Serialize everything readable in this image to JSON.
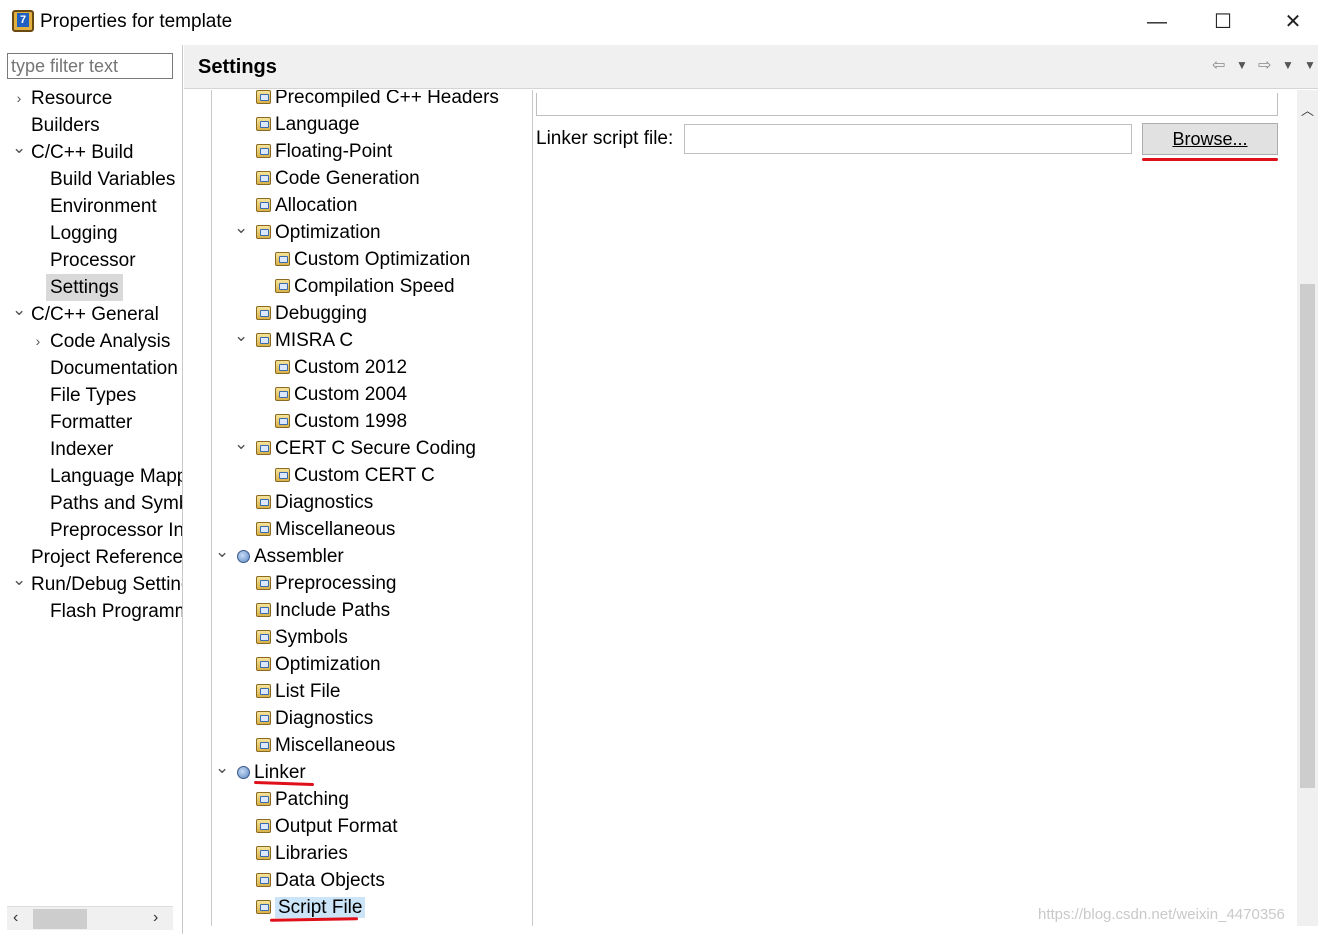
{
  "window": {
    "title": "Properties for template",
    "minimize": "—",
    "maximize": "☐",
    "close": "✕"
  },
  "filter": {
    "placeholder": "type filter text"
  },
  "left_nav": [
    {
      "label": "Resource",
      "level": 0,
      "expander": "collapsed"
    },
    {
      "label": "Builders",
      "level": 0,
      "expander": "none"
    },
    {
      "label": "C/C++ Build",
      "level": 0,
      "expander": "expanded"
    },
    {
      "label": "Build Variables",
      "level": 1,
      "expander": "none"
    },
    {
      "label": "Environment",
      "level": 1,
      "expander": "none"
    },
    {
      "label": "Logging",
      "level": 1,
      "expander": "none"
    },
    {
      "label": "Processor",
      "level": 1,
      "expander": "none"
    },
    {
      "label": "Settings",
      "level": 1,
      "expander": "none",
      "selected": true
    },
    {
      "label": "C/C++ General",
      "level": 0,
      "expander": "expanded"
    },
    {
      "label": "Code Analysis",
      "level": 1,
      "expander": "collapsed"
    },
    {
      "label": "Documentation",
      "level": 1,
      "expander": "none"
    },
    {
      "label": "File Types",
      "level": 1,
      "expander": "none"
    },
    {
      "label": "Formatter",
      "level": 1,
      "expander": "none"
    },
    {
      "label": "Indexer",
      "level": 1,
      "expander": "none"
    },
    {
      "label": "Language Mappings",
      "level": 1,
      "expander": "none"
    },
    {
      "label": "Paths and Symbols",
      "level": 1,
      "expander": "none"
    },
    {
      "label": "Preprocessor Include",
      "level": 1,
      "expander": "none"
    },
    {
      "label": "Project References",
      "level": 0,
      "expander": "none"
    },
    {
      "label": "Run/Debug Settings",
      "level": 0,
      "expander": "expanded"
    },
    {
      "label": "Flash Programmer",
      "level": 1,
      "expander": "none"
    }
  ],
  "header": {
    "title": "Settings"
  },
  "tree": [
    {
      "label": "Precompiled C++ Headers",
      "level": 2,
      "icon": "folder",
      "expander": "none"
    },
    {
      "label": "Language",
      "level": 2,
      "icon": "folder",
      "expander": "none"
    },
    {
      "label": "Floating-Point",
      "level": 2,
      "icon": "folder",
      "expander": "none"
    },
    {
      "label": "Code Generation",
      "level": 2,
      "icon": "folder",
      "expander": "none"
    },
    {
      "label": "Allocation",
      "level": 2,
      "icon": "folder",
      "expander": "none"
    },
    {
      "label": "Optimization",
      "level": 2,
      "icon": "folder",
      "expander": "expanded"
    },
    {
      "label": "Custom Optimization",
      "level": 3,
      "icon": "folder",
      "expander": "none"
    },
    {
      "label": "Compilation Speed",
      "level": 3,
      "icon": "folder",
      "expander": "none"
    },
    {
      "label": "Debugging",
      "level": 2,
      "icon": "folder",
      "expander": "none"
    },
    {
      "label": "MISRA C",
      "level": 2,
      "icon": "folder",
      "expander": "expanded"
    },
    {
      "label": "Custom 2012",
      "level": 3,
      "icon": "folder",
      "expander": "none"
    },
    {
      "label": "Custom 2004",
      "level": 3,
      "icon": "folder",
      "expander": "none"
    },
    {
      "label": "Custom 1998",
      "level": 3,
      "icon": "folder",
      "expander": "none"
    },
    {
      "label": "CERT C Secure Coding",
      "level": 2,
      "icon": "folder",
      "expander": "expanded"
    },
    {
      "label": "Custom CERT C",
      "level": 3,
      "icon": "folder",
      "expander": "none"
    },
    {
      "label": "Diagnostics",
      "level": 2,
      "icon": "folder",
      "expander": "none"
    },
    {
      "label": "Miscellaneous",
      "level": 2,
      "icon": "folder",
      "expander": "none"
    },
    {
      "label": "Assembler",
      "level": 1,
      "icon": "globe",
      "expander": "expanded"
    },
    {
      "label": "Preprocessing",
      "level": 2,
      "icon": "folder",
      "expander": "none"
    },
    {
      "label": "Include Paths",
      "level": 2,
      "icon": "folder",
      "expander": "none"
    },
    {
      "label": "Symbols",
      "level": 2,
      "icon": "folder",
      "expander": "none"
    },
    {
      "label": "Optimization",
      "level": 2,
      "icon": "folder",
      "expander": "none"
    },
    {
      "label": "List File",
      "level": 2,
      "icon": "folder",
      "expander": "none"
    },
    {
      "label": "Diagnostics",
      "level": 2,
      "icon": "folder",
      "expander": "none"
    },
    {
      "label": "Miscellaneous",
      "level": 2,
      "icon": "folder",
      "expander": "none"
    },
    {
      "label": "Linker",
      "level": 1,
      "icon": "globe",
      "expander": "expanded"
    },
    {
      "label": "Patching",
      "level": 2,
      "icon": "folder",
      "expander": "none"
    },
    {
      "label": "Output Format",
      "level": 2,
      "icon": "folder",
      "expander": "none"
    },
    {
      "label": "Libraries",
      "level": 2,
      "icon": "folder",
      "expander": "none"
    },
    {
      "label": "Data Objects",
      "level": 2,
      "icon": "folder",
      "expander": "none"
    },
    {
      "label": "Script File",
      "level": 2,
      "icon": "folder",
      "expander": "none",
      "selected": true
    }
  ],
  "content": {
    "linker_script_label": "Linker script file:",
    "linker_script_value": "",
    "browse_label": "Browse..."
  },
  "watermark": "https://blog.csdn.net/weixin_4470356",
  "colors": {
    "annotation": "#e0101a",
    "selection": "#cce4f7",
    "nav_selection": "#d9d9d9"
  }
}
